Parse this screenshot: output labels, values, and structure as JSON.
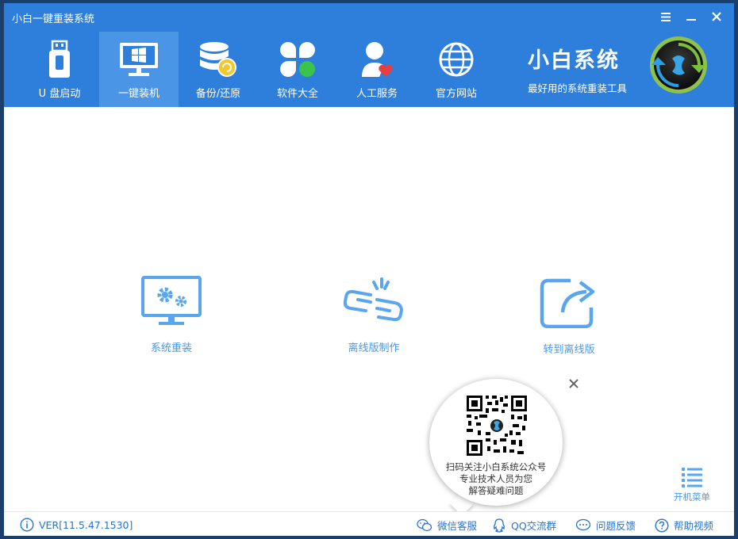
{
  "window": {
    "title": "小白一键重装系统"
  },
  "nav": {
    "items": [
      {
        "label": "U 盘启动",
        "icon": "usb-drive-icon"
      },
      {
        "label": "一键装机",
        "icon": "monitor-windows-icon",
        "active": true
      },
      {
        "label": "备份/还原",
        "icon": "database-backup-icon"
      },
      {
        "label": "软件大全",
        "icon": "apps-clover-icon"
      },
      {
        "label": "人工服务",
        "icon": "person-heart-icon"
      },
      {
        "label": "官方网站",
        "icon": "globe-icon"
      }
    ]
  },
  "brand": {
    "title": "小白系统",
    "subtitle": "最好用的系统重装工具"
  },
  "features": {
    "reinstall": "系统重装",
    "offline_make": "离线版制作",
    "to_offline": "转到离线版"
  },
  "popup": {
    "line1": "扫码关注小白系统公众号",
    "line2": "专业技术人员为您",
    "line3": "解答疑难问题"
  },
  "boot_menu": {
    "label": "开机菜单"
  },
  "footer": {
    "version": "VER[11.5.47.1530]",
    "wechat": "微信客服",
    "qq": "QQ交流群",
    "feedback": "问题反馈",
    "help": "帮助视频"
  },
  "colors": {
    "header": "#2e7fdb",
    "active_tab": "#4a95e6",
    "accent": "#4b98e8"
  }
}
